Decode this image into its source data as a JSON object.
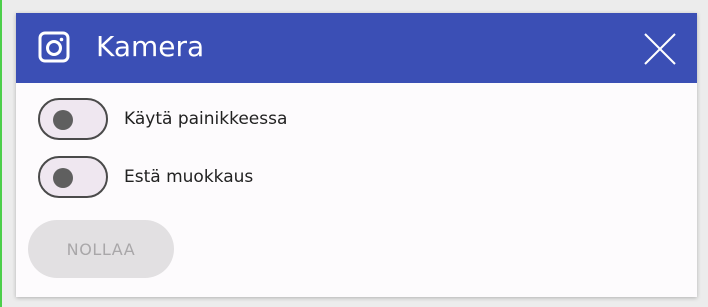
{
  "dialog": {
    "title": "Kamera",
    "icons": {
      "header": "camera-icon",
      "close": "close-icon"
    },
    "header_color": "#3b4fb5"
  },
  "toggles": [
    {
      "label": "Käytä painikkeessa",
      "state": "off"
    },
    {
      "label": "Estä muokkaus",
      "state": "off"
    }
  ],
  "reset": {
    "label": "NOLLAA",
    "state": "disabled"
  }
}
